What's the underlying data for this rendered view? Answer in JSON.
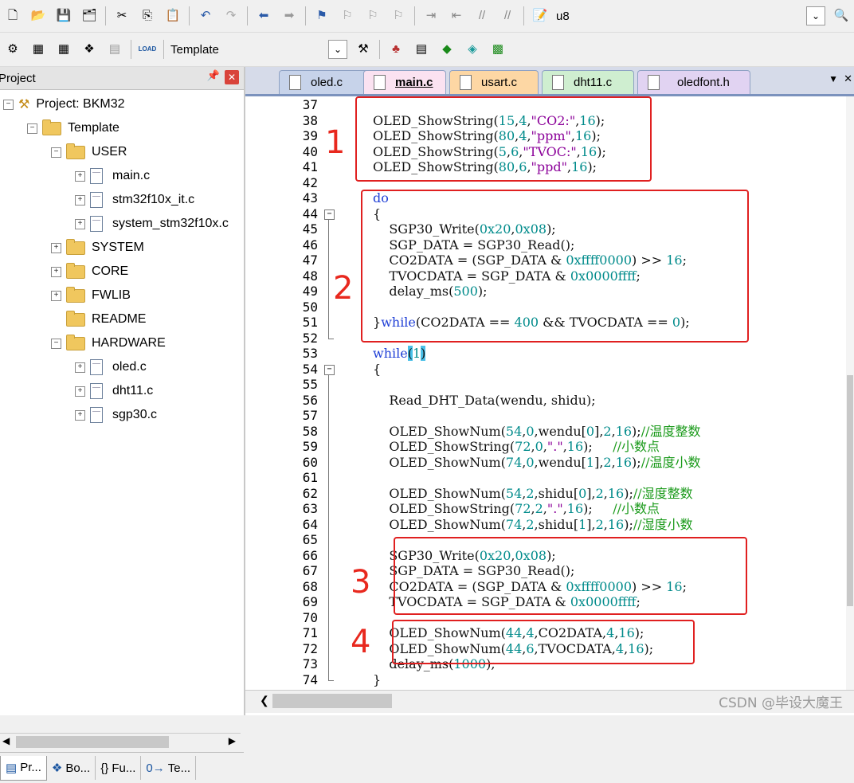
{
  "toolbar1": {
    "combo_value": "u8"
  },
  "toolbar2": {
    "load_label": "LOAD",
    "target_value": "Template"
  },
  "project_panel": {
    "title": "Project",
    "tree": [
      {
        "label": "Project: BKM32",
        "kind": "project"
      },
      {
        "label": "Template",
        "kind": "target"
      },
      {
        "label": "USER",
        "kind": "folder"
      },
      {
        "label": "main.c",
        "kind": "file"
      },
      {
        "label": "stm32f10x_it.c",
        "kind": "file"
      },
      {
        "label": "system_stm32f10x.c",
        "kind": "file"
      },
      {
        "label": "SYSTEM",
        "kind": "folder"
      },
      {
        "label": "CORE",
        "kind": "folder"
      },
      {
        "label": "FWLIB",
        "kind": "folder"
      },
      {
        "label": "README",
        "kind": "folder"
      },
      {
        "label": "HARDWARE",
        "kind": "folder"
      },
      {
        "label": "oled.c",
        "kind": "file"
      },
      {
        "label": "dht11.c",
        "kind": "file"
      },
      {
        "label": "sgp30.c",
        "kind": "file"
      }
    ],
    "bottom_tabs": [
      "Pr...",
      "Bo...",
      "{} Fu...",
      "Te..."
    ]
  },
  "editor": {
    "tabs": [
      {
        "label": "oled.c",
        "color": "#c7d3ea"
      },
      {
        "label": "main.c",
        "color": "#fbe2f1",
        "active": true
      },
      {
        "label": "usart.c",
        "color": "#fdd7a4"
      },
      {
        "label": "dht11.c",
        "color": "#cfeed0"
      },
      {
        "label": "oledfont.h",
        "color": "#e1d3f2"
      }
    ],
    "lines": [
      {
        "n": "37",
        "t": ""
      },
      {
        "n": "38",
        "t": "OLED_ShowString(15,4,\"CO2:\",16);"
      },
      {
        "n": "39",
        "t": "OLED_ShowString(80,4,\"ppm\",16);"
      },
      {
        "n": "40",
        "t": "OLED_ShowString(5,6,\"TVOC:\",16);"
      },
      {
        "n": "41",
        "t": "OLED_ShowString(80,6,\"ppd\",16);"
      },
      {
        "n": "42",
        "t": ""
      },
      {
        "n": "43",
        "t": "do"
      },
      {
        "n": "44",
        "t": "{"
      },
      {
        "n": "45",
        "t": "    SGP30_Write(0x20,0x08);"
      },
      {
        "n": "46",
        "t": "    SGP_DATA = SGP30_Read();"
      },
      {
        "n": "47",
        "t": "    CO2DATA = (SGP_DATA & 0xffff0000) >> 16;"
      },
      {
        "n": "48",
        "t": "    TVOCDATA = SGP_DATA & 0x0000ffff;"
      },
      {
        "n": "49",
        "t": "    delay_ms(500);"
      },
      {
        "n": "50",
        "t": ""
      },
      {
        "n": "51",
        "t": "}while(CO2DATA == 400 && TVOCDATA == 0);"
      },
      {
        "n": "52",
        "t": ""
      },
      {
        "n": "53",
        "t": "while(1)"
      },
      {
        "n": "54",
        "t": "{"
      },
      {
        "n": "55",
        "t": ""
      },
      {
        "n": "56",
        "t": "    Read_DHT_Data(wendu, shidu);"
      },
      {
        "n": "57",
        "t": ""
      },
      {
        "n": "58",
        "t": "    OLED_ShowNum(54,0,wendu[0],2,16);//温度整数"
      },
      {
        "n": "59",
        "t": "    OLED_ShowString(72,0,\".\",16);     //小数点"
      },
      {
        "n": "60",
        "t": "    OLED_ShowNum(74,0,wendu[1],2,16);//温度小数"
      },
      {
        "n": "61",
        "t": ""
      },
      {
        "n": "62",
        "t": "    OLED_ShowNum(54,2,shidu[0],2,16);//湿度整数"
      },
      {
        "n": "63",
        "t": "    OLED_ShowString(72,2,\".\",16);     //小数点"
      },
      {
        "n": "64",
        "t": "    OLED_ShowNum(74,2,shidu[1],2,16);//湿度小数"
      },
      {
        "n": "65",
        "t": ""
      },
      {
        "n": "66",
        "t": "    SGP30_Write(0x20,0x08);"
      },
      {
        "n": "67",
        "t": "    SGP_DATA = SGP30_Read();"
      },
      {
        "n": "68",
        "t": "    CO2DATA = (SGP_DATA & 0xffff0000) >> 16;"
      },
      {
        "n": "69",
        "t": "    TVOCDATA = SGP_DATA & 0x0000ffff;"
      },
      {
        "n": "70",
        "t": ""
      },
      {
        "n": "71",
        "t": "    OLED_ShowNum(44,4,CO2DATA,4,16);"
      },
      {
        "n": "72",
        "t": "    OLED_ShowNum(44,6,TVOCDATA,4,16);"
      },
      {
        "n": "73",
        "t": "    delay_ms(1000);"
      },
      {
        "n": "74",
        "t": "}"
      }
    ],
    "annotations": [
      "1",
      "2",
      "3",
      "4"
    ]
  },
  "watermark": "CSDN @毕设大魔王",
  "colors": {
    "keyword": "#1f3fd6",
    "number": "#008b8b",
    "string": "#8b0099",
    "comment": "#1a9a1a",
    "annotation_red": "#e02020"
  }
}
